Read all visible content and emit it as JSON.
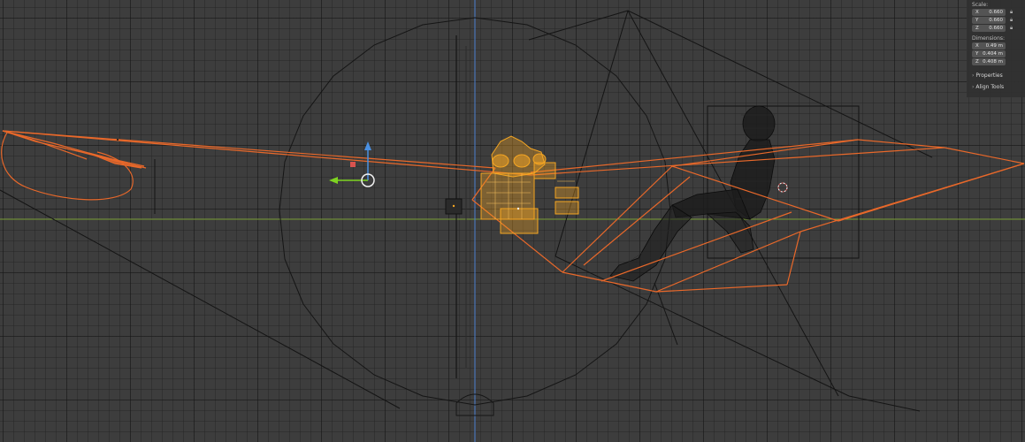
{
  "npanel": {
    "scale_label": "Scale:",
    "scale": [
      {
        "axis": "X",
        "value": "0.660"
      },
      {
        "axis": "Y",
        "value": "0.660"
      },
      {
        "axis": "Z",
        "value": "0.660"
      }
    ],
    "dimensions_label": "Dimensions:",
    "dimensions": [
      {
        "axis": "X",
        "value": "0.49 m"
      },
      {
        "axis": "Y",
        "value": "0.404 m"
      },
      {
        "axis": "Z",
        "value": "0.408 m"
      }
    ],
    "sections": [
      {
        "label": "Properties"
      },
      {
        "label": "Align Tools"
      }
    ]
  },
  "colors": {
    "background": "#3d3d3d",
    "selection_orange": "#e8682a",
    "active_orange": "#f5a623",
    "wire_black": "#111111",
    "axis_x_green": "#7fa53a",
    "axis_z_blue": "#4a7fcf",
    "gizmo_x": "#7ed321",
    "gizmo_z": "#4a90e2",
    "gizmo_y": "#d9534f"
  },
  "icons": {
    "lock": "lock-icon",
    "chevron": "chevron-right-icon",
    "cursor": "3d-cursor-icon",
    "camera": "camera-icon"
  }
}
